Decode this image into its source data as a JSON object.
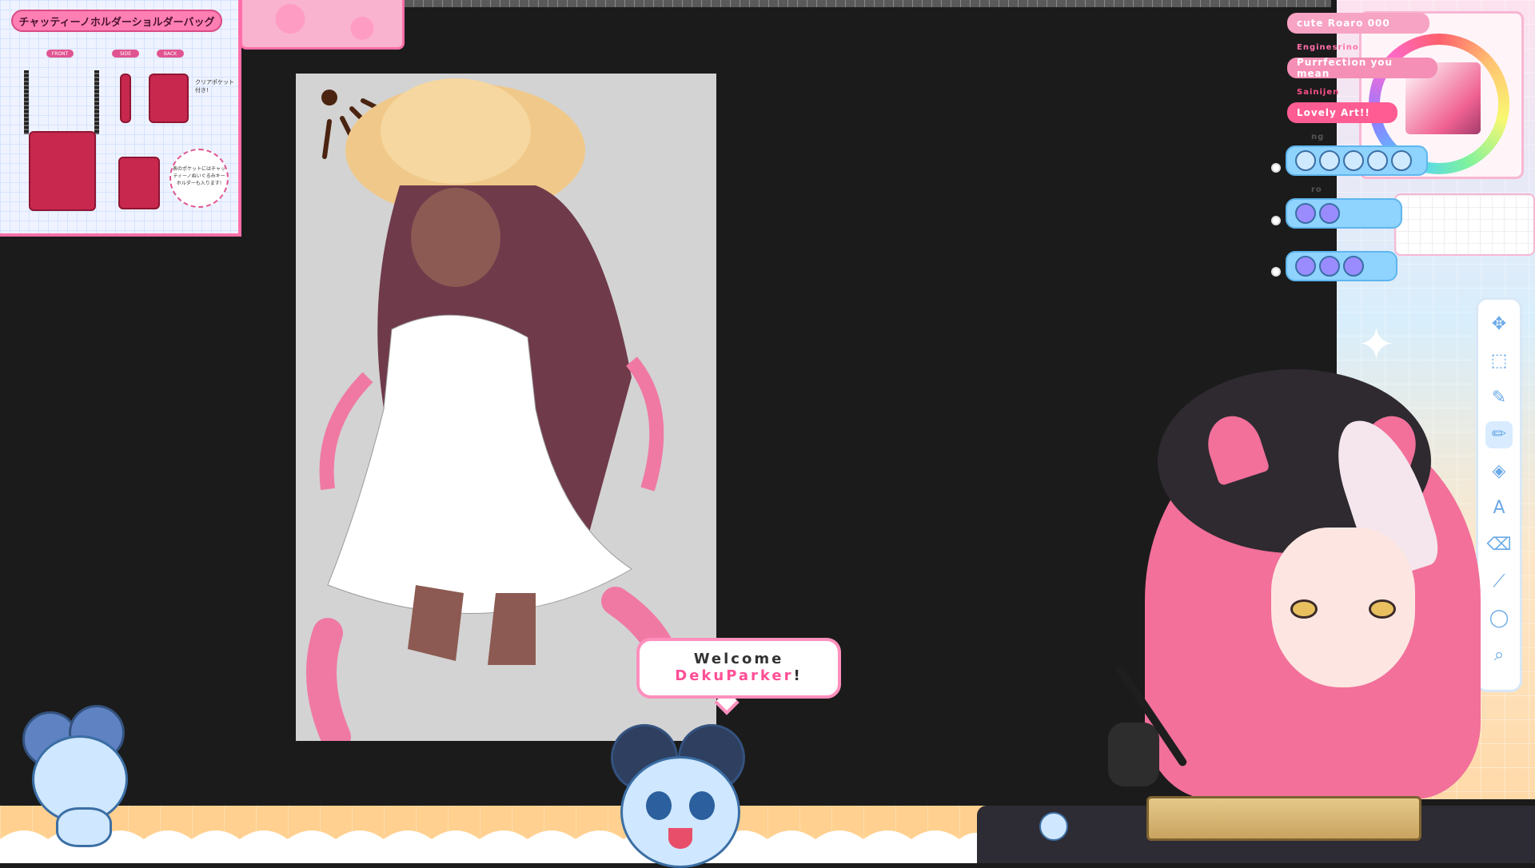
{
  "reference": {
    "title": "チャッティーノホルダーショルダーバッグ",
    "tags": [
      "FRONT",
      "SIDE",
      "BACK"
    ],
    "pocket_note": "クリアポケット付き!",
    "circle_note": "表のポケットにはチャッティーノぬいぐるみキーホルダーも入ります!"
  },
  "welcome": {
    "line1": "Welcome",
    "name": "DekuParker",
    "suffix": "!"
  },
  "chat": {
    "messages": [
      {
        "user": "",
        "text": "cute Roaro 000"
      },
      {
        "user": "Enginesrino",
        "text": "Purrfection you mean"
      },
      {
        "user": "Sainijen",
        "text": "Lovely Art!!"
      }
    ],
    "emote_rows": [
      {
        "user": "ng",
        "count": 5
      },
      {
        "user": "ro",
        "count": 2
      },
      {
        "user": "",
        "count": 3
      }
    ]
  },
  "tools": [
    {
      "name": "move-tool",
      "glyph": "✥"
    },
    {
      "name": "select-tool",
      "glyph": "⬚"
    },
    {
      "name": "eyedropper-tool",
      "glyph": "✎"
    },
    {
      "name": "pen-tool",
      "glyph": "✏"
    },
    {
      "name": "fill-tool",
      "glyph": "◈"
    },
    {
      "name": "text-tool",
      "glyph": "A"
    },
    {
      "name": "eraser-tool",
      "glyph": "⌫"
    },
    {
      "name": "line-tool",
      "glyph": "⟋"
    },
    {
      "name": "ellipse-tool",
      "glyph": "◯"
    },
    {
      "name": "zoom-tool",
      "glyph": "⌕"
    }
  ],
  "colors": {
    "accent_pink": "#ff6fa8",
    "chat_pink": "#ff5c93",
    "emote_blue": "#8fd3ff"
  }
}
